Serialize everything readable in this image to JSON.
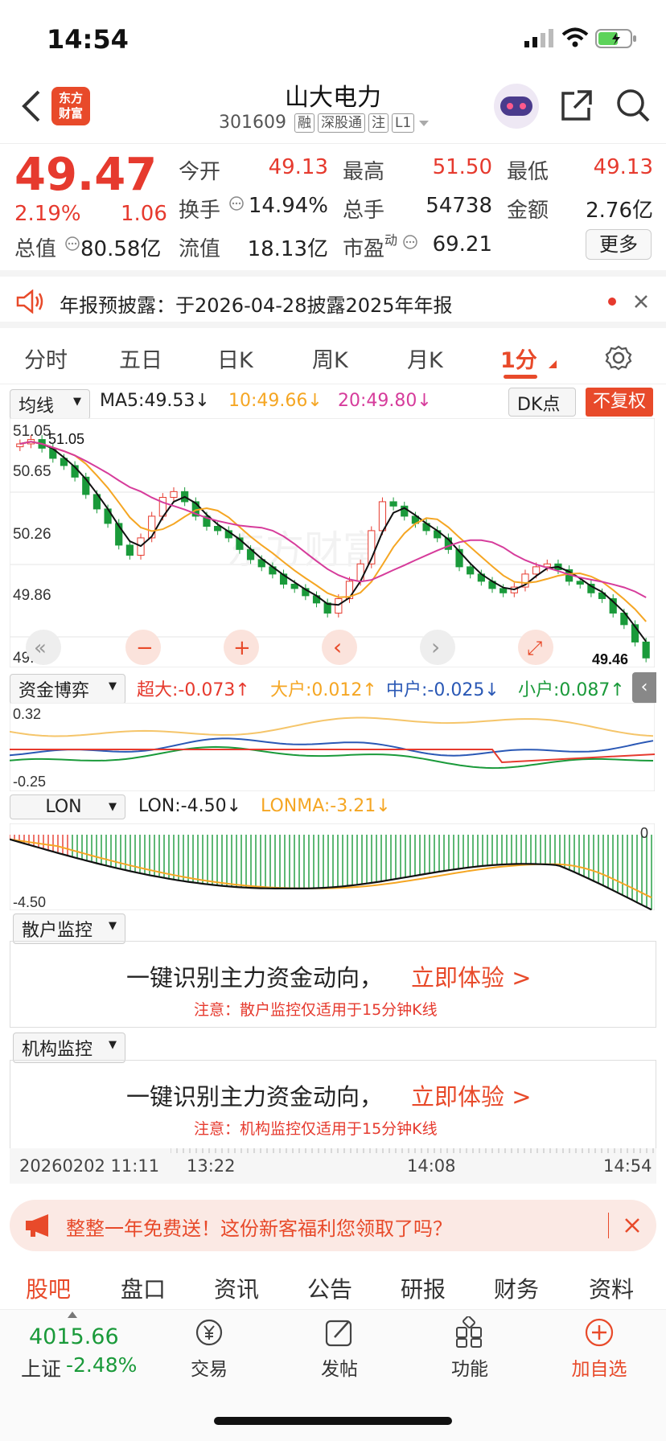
{
  "status": {
    "time": "14:54"
  },
  "header": {
    "name": "山大电力",
    "code": "301609",
    "tags": [
      "融",
      "深股通",
      "注",
      "L1"
    ],
    "logo_text": "东方\n财富"
  },
  "quote": {
    "price": "49.47",
    "change_pct": "2.19%",
    "change": "1.06",
    "rows": [
      [
        [
          "今开",
          "49.13",
          "red"
        ],
        [
          "最高",
          "51.50",
          "red"
        ],
        [
          "最低",
          "49.13",
          "red"
        ]
      ],
      [
        [
          "换手",
          "14.94%",
          "dark"
        ],
        [
          "总手",
          "54738",
          "dark"
        ],
        [
          "金额",
          "2.76亿",
          "dark"
        ]
      ],
      [
        [
          "流值",
          "18.13亿",
          "dark"
        ],
        [
          "市盈",
          "69.21",
          "dark"
        ]
      ]
    ],
    "total_value_label": "总值",
    "total_value": "80.58亿",
    "pe_superscript": "动",
    "more_label": "更多"
  },
  "notice": {
    "text": "年报预披露：于2026-04-28披露2025年年报"
  },
  "period_tabs": [
    "分时",
    "五日",
    "日K",
    "周K",
    "月K",
    "1分"
  ],
  "active_tab": "1分",
  "ma_bar": {
    "dropdown": "均线",
    "ma5": "MA5:49.53↓",
    "ma10": "10:49.66↓",
    "ma20": "20:49.80↓",
    "dk_button": "DK点",
    "fq_button": "不复权"
  },
  "colors": {
    "red": "#e63a2e",
    "green": "#1a9a3a",
    "orange": "#f5a623",
    "magenta": "#d63c9b",
    "blue": "#2a58b5",
    "accent": "#e84a2a"
  },
  "chart_data": [
    {
      "type": "candlestick",
      "y_ticks": [
        "51.05",
        "50.65",
        "50.26",
        "49.86",
        "49.46"
      ],
      "ylim": [
        49.46,
        51.05
      ],
      "high_label": "51.05",
      "last_label": "49.46",
      "close": [
        50.95,
        50.98,
        50.92,
        50.85,
        50.8,
        50.72,
        50.6,
        50.5,
        50.4,
        50.25,
        50.18,
        50.3,
        50.45,
        50.58,
        50.62,
        50.55,
        50.45,
        50.38,
        50.35,
        50.3,
        50.22,
        50.15,
        50.1,
        50.05,
        49.98,
        49.95,
        49.9,
        49.85,
        49.78,
        49.88,
        50.0,
        50.12,
        50.35,
        50.55,
        50.52,
        50.45,
        50.4,
        50.35,
        50.3,
        50.22,
        50.1,
        50.05,
        50.0,
        49.95,
        49.92,
        49.96,
        50.05,
        50.1,
        50.12,
        50.08,
        50.0,
        49.98,
        49.92,
        49.88,
        49.78,
        49.7,
        49.58,
        49.47
      ]
    },
    {
      "type": "line",
      "name": "资金博弈",
      "y_ticks": [
        "0.32",
        "-0.25"
      ],
      "labels": [
        "超大:-0.073↑",
        "大户:0.012↑",
        "中户:-0.025↓",
        "小户:0.087↑"
      ],
      "ylim": [
        -0.25,
        0.32
      ]
    },
    {
      "type": "bar",
      "name": "LON",
      "labels": [
        "LON:-4.50↓",
        "LONMA:-3.21↓"
      ],
      "y_ticks": [
        "0",
        "-4.50"
      ],
      "ylim": [
        -4.5,
        0
      ]
    }
  ],
  "sections": [
    {
      "dropdown": "散户监控",
      "title": "一键识别主力资金动向，",
      "cta": "立即体验 >",
      "note": "注意：散户监控仅适用于15分钟K线"
    },
    {
      "dropdown": "机构监控",
      "title": "一键识别主力资金动向，",
      "cta": "立即体验 >",
      "note": "注意：机构监控仅适用于15分钟K线"
    }
  ],
  "time_axis": [
    "20260202 11:11",
    "13:22",
    "14:08",
    "14:54"
  ],
  "chart_controls": [
    "«",
    "−",
    "+",
    "‹",
    "›",
    "⤢"
  ],
  "promo": {
    "text": "整整一年免费送！这份新客福利您领取了吗？"
  },
  "bottom_tabs": [
    "股吧",
    "盘口",
    "资讯",
    "公告",
    "研报",
    "财务",
    "资料"
  ],
  "nav": {
    "index_value": "4015.66",
    "index_name": "上证",
    "index_change": "-2.48%",
    "items": [
      "交易",
      "发帖",
      "功能",
      "加自选"
    ]
  }
}
